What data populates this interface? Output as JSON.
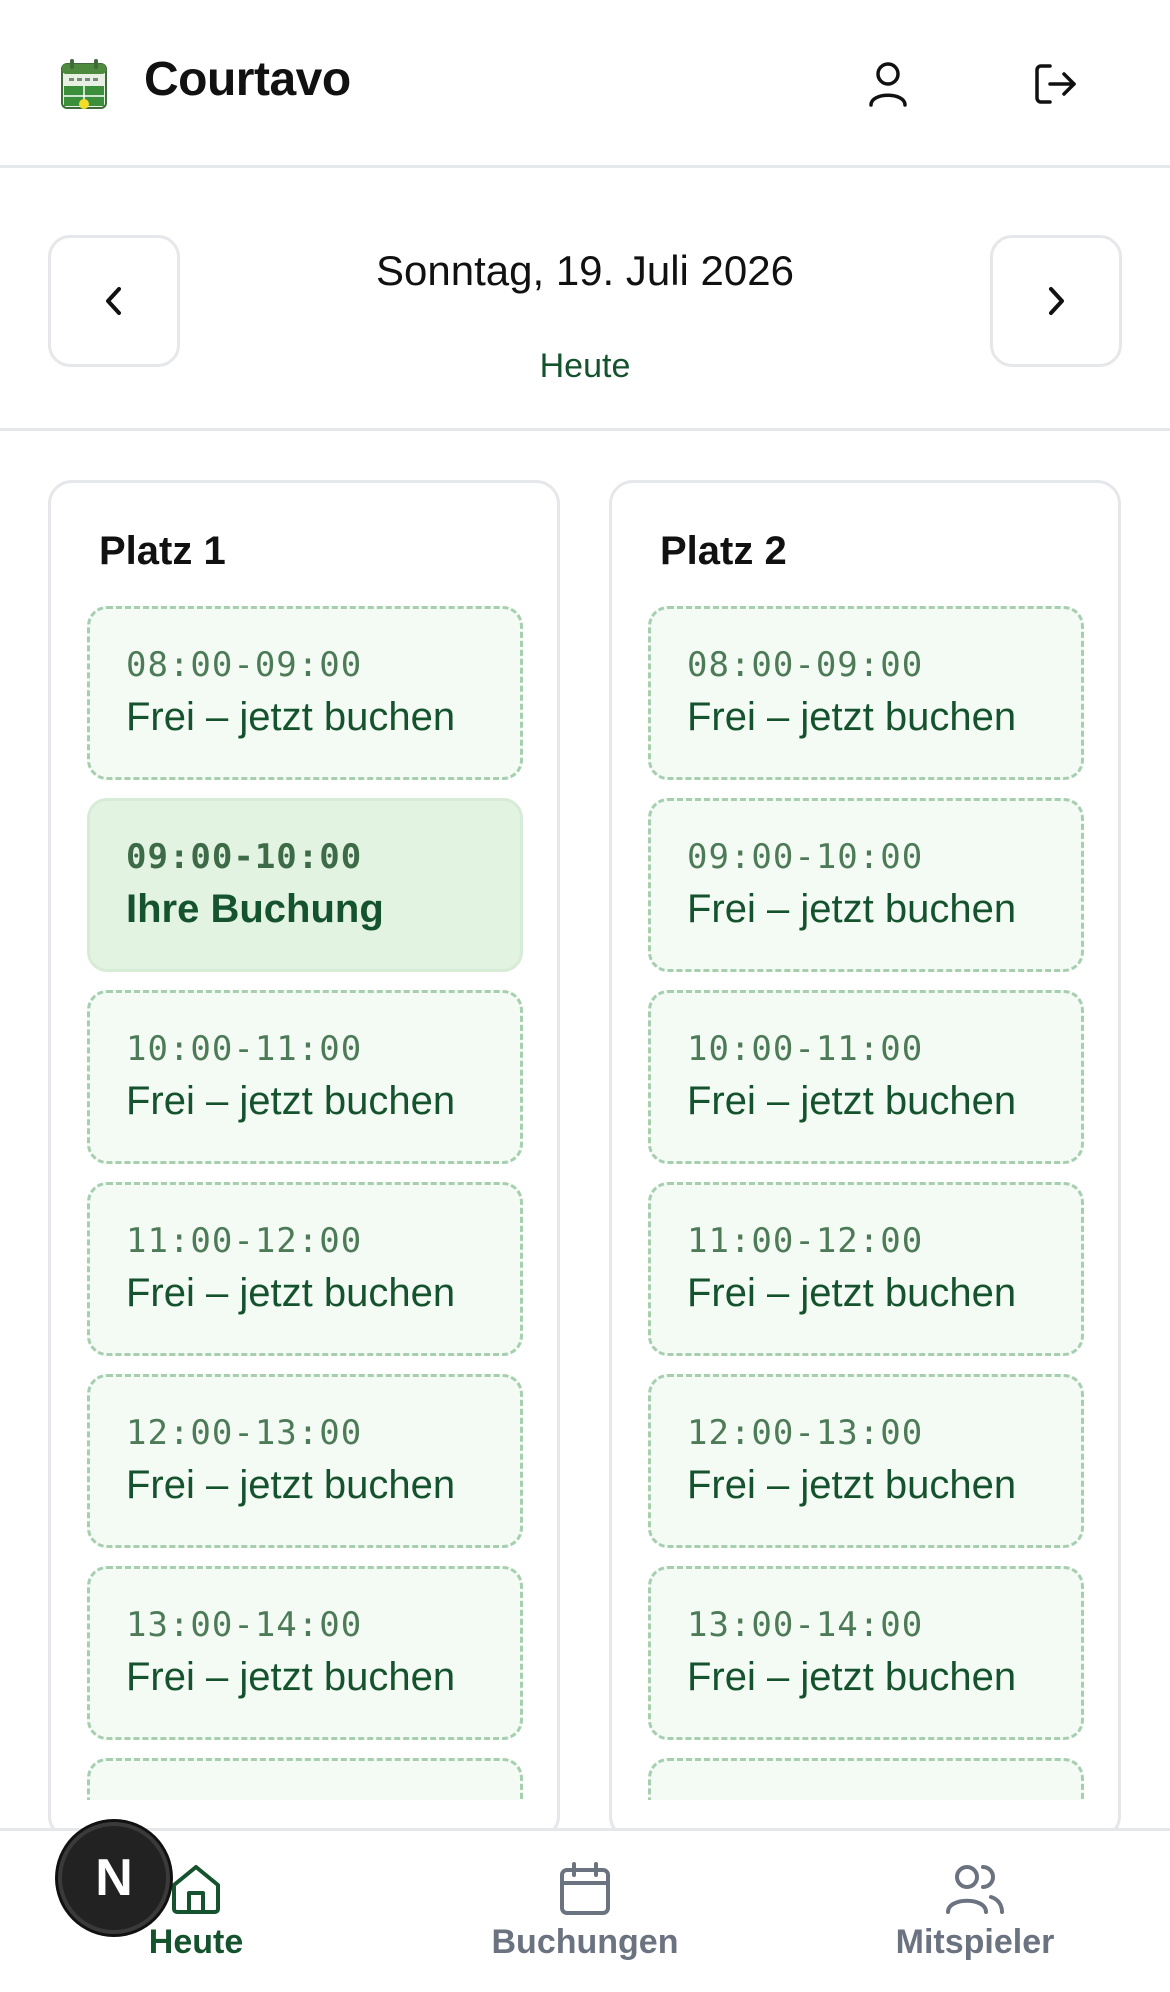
{
  "header": {
    "app_title": "Courtavo",
    "logo_icon": "court-calendar-logo",
    "user_icon": "user-icon",
    "logout_icon": "logout-icon"
  },
  "date_nav": {
    "date_label": "Sonntag, 19. Juli 2026",
    "today_label": "Heute",
    "prev_icon": "chevron-left-icon",
    "next_icon": "chevron-right-icon"
  },
  "courts": [
    {
      "name": "Platz 1",
      "slots": [
        {
          "time": "08:00-09:00",
          "label": "Frei – jetzt buchen",
          "status": "free"
        },
        {
          "time": "09:00-10:00",
          "label": "Ihre Buchung",
          "status": "booked"
        },
        {
          "time": "10:00-11:00",
          "label": "Frei – jetzt buchen",
          "status": "free"
        },
        {
          "time": "11:00-12:00",
          "label": "Frei – jetzt buchen",
          "status": "free"
        },
        {
          "time": "12:00-13:00",
          "label": "Frei – jetzt buchen",
          "status": "free"
        },
        {
          "time": "13:00-14:00",
          "label": "Frei – jetzt buchen",
          "status": "free"
        }
      ]
    },
    {
      "name": "Platz 2",
      "slots": [
        {
          "time": "08:00-09:00",
          "label": "Frei – jetzt buchen",
          "status": "free"
        },
        {
          "time": "09:00-10:00",
          "label": "Frei – jetzt buchen",
          "status": "free"
        },
        {
          "time": "10:00-11:00",
          "label": "Frei – jetzt buchen",
          "status": "free"
        },
        {
          "time": "11:00-12:00",
          "label": "Frei – jetzt buchen",
          "status": "free"
        },
        {
          "time": "12:00-13:00",
          "label": "Frei – jetzt buchen",
          "status": "free"
        },
        {
          "time": "13:00-14:00",
          "label": "Frei – jetzt buchen",
          "status": "free"
        }
      ]
    }
  ],
  "bottom_nav": {
    "tabs": [
      {
        "label": "Heute",
        "icon": "home-icon",
        "active": true
      },
      {
        "label": "Buchungen",
        "icon": "calendar-icon",
        "active": false
      },
      {
        "label": "Mitspieler",
        "icon": "users-icon",
        "active": false
      }
    ]
  },
  "dev_badge": {
    "letter": "N"
  },
  "colors": {
    "accent": "#14532d",
    "free_slot_bg": "#f4faf4",
    "free_slot_border": "#a7cfaf",
    "booked_slot_bg": "#e3f3e1",
    "muted": "#6b7280"
  }
}
